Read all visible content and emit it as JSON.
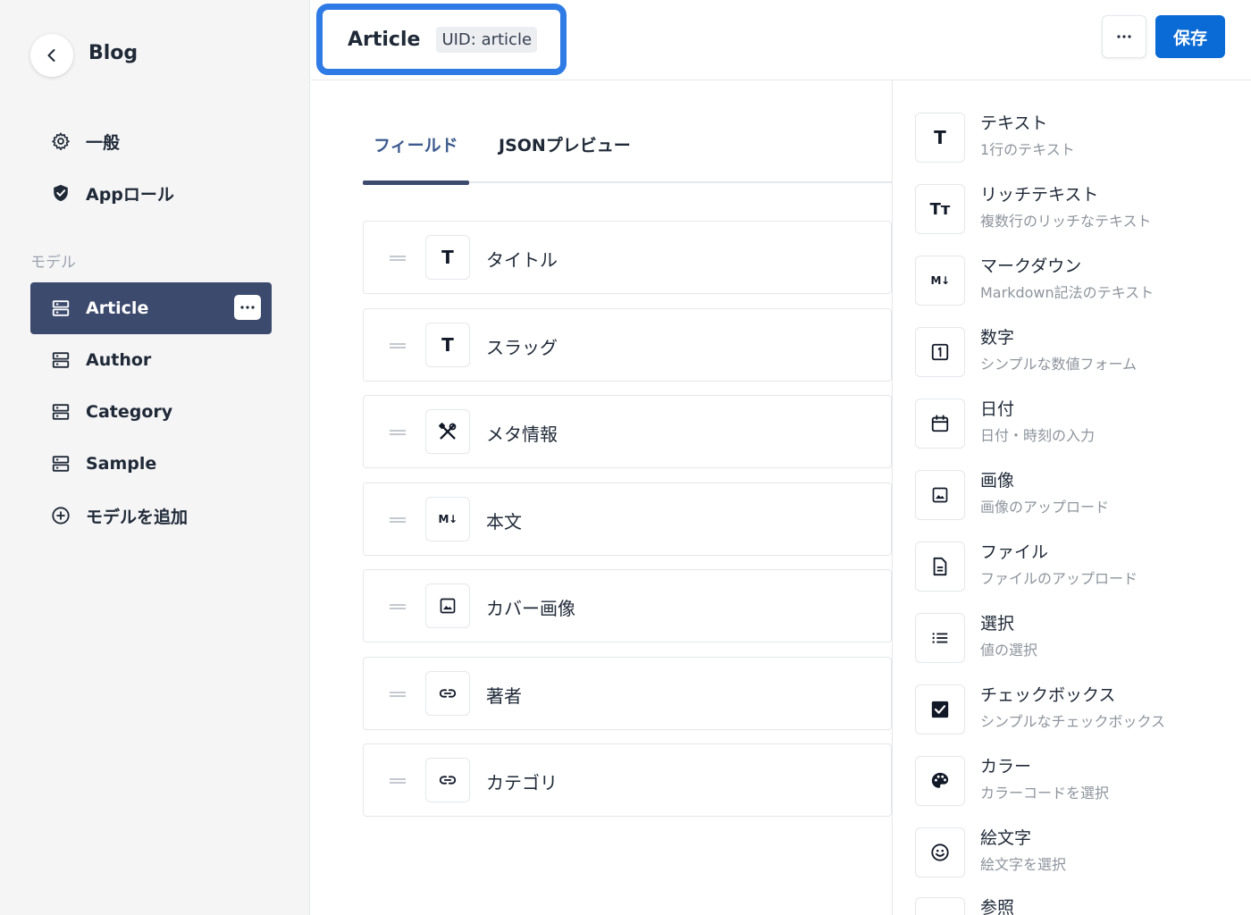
{
  "sidebar": {
    "back_icon": "chevron-left-icon",
    "app_name": "Blog",
    "nav": [
      {
        "label": "一般",
        "icon": "gear-icon"
      },
      {
        "label": "Appロール",
        "icon": "shield-check-icon"
      }
    ],
    "section_label": "モデル",
    "models": [
      {
        "label": "Article",
        "icon": "database-icon",
        "active": true
      },
      {
        "label": "Author",
        "icon": "database-icon"
      },
      {
        "label": "Category",
        "icon": "database-icon"
      },
      {
        "label": "Sample",
        "icon": "database-icon"
      }
    ],
    "add_model_label": "モデルを追加",
    "colors": {
      "background": "#f5f5f6",
      "active": "#3c4a6e"
    }
  },
  "header": {
    "model_title": "Article",
    "uid_badge": "UID: article",
    "more_label": "···",
    "save_label": "保存",
    "colors": {
      "save": "#0b6bd6",
      "focus_ring": "#2f7be6"
    }
  },
  "main": {
    "tabs": [
      {
        "label": "フィールド",
        "active": true
      },
      {
        "label": "JSONプレビュー",
        "active": false
      }
    ],
    "fields": [
      {
        "label": "タイトル",
        "icon": "text-icon",
        "glyph": "T"
      },
      {
        "label": "スラッグ",
        "icon": "text-icon",
        "glyph": "T"
      },
      {
        "label": "メタ情報",
        "icon": "tools-icon"
      },
      {
        "label": "本文",
        "icon": "markdown-icon",
        "glyph": "M↓"
      },
      {
        "label": "カバー画像",
        "icon": "image-icon"
      },
      {
        "label": "著者",
        "icon": "link-icon"
      },
      {
        "label": "カテゴリ",
        "icon": "link-icon"
      }
    ]
  },
  "field_types": [
    {
      "name": "テキスト",
      "desc": "1行のテキスト",
      "icon": "text-icon",
      "glyph": "T"
    },
    {
      "name": "リッチテキスト",
      "desc": "複数行のリッチなテキスト",
      "icon": "rich-text-icon",
      "glyph": "Tт"
    },
    {
      "name": "マークダウン",
      "desc": "Markdown記法のテキスト",
      "icon": "markdown-icon",
      "glyph": "M↓"
    },
    {
      "name": "数字",
      "desc": "シンプルな数値フォーム",
      "icon": "number-icon"
    },
    {
      "name": "日付",
      "desc": "日付・時刻の入力",
      "icon": "calendar-icon"
    },
    {
      "name": "画像",
      "desc": "画像のアップロード",
      "icon": "image-icon"
    },
    {
      "name": "ファイル",
      "desc": "ファイルのアップロード",
      "icon": "file-icon"
    },
    {
      "name": "選択",
      "desc": "値の選択",
      "icon": "list-icon"
    },
    {
      "name": "チェックボックス",
      "desc": "シンプルなチェックボックス",
      "icon": "checkbox-icon"
    },
    {
      "name": "カラー",
      "desc": "カラーコードを選択",
      "icon": "palette-icon"
    },
    {
      "name": "絵文字",
      "desc": "絵文字を選択",
      "icon": "smile-icon"
    },
    {
      "name": "参照",
      "desc": "",
      "icon": "reference-icon"
    }
  ]
}
